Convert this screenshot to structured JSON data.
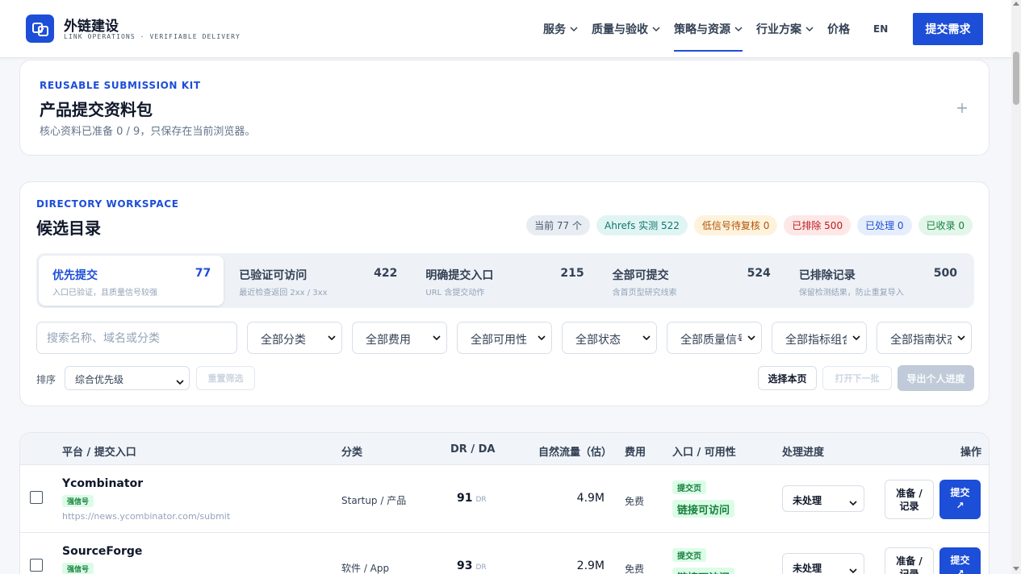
{
  "header": {
    "brand_name": "外链建设",
    "brand_sub": "LINK OPERATIONS · VERIFIABLE DELIVERY",
    "nav": [
      {
        "label": "服务"
      },
      {
        "label": "质量与验收"
      },
      {
        "label": "策略与资源"
      },
      {
        "label": "行业方案"
      },
      {
        "label": "价格"
      }
    ],
    "lang": "EN",
    "cta": "提交需求"
  },
  "kit": {
    "eyebrow": "REUSABLE SUBMISSION KIT",
    "title": "产品提交资料包",
    "desc": "核心资料已准备 0 / 9，只保存在当前浏览器。",
    "expand_icon": "plus-icon"
  },
  "directory": {
    "eyebrow": "DIRECTORY WORKSPACE",
    "title": "候选目录",
    "pills": [
      {
        "label": "当前 77 个",
        "bg": "#e8edf4",
        "fg": "#475569"
      },
      {
        "label": "Ahrefs 实测 522",
        "bg": "#e0f5f3",
        "fg": "#0f766e"
      },
      {
        "label": "低信号待复核 0",
        "bg": "#fdf3dc",
        "fg": "#b45309"
      },
      {
        "label": "已排除 500",
        "bg": "#fde7e7",
        "fg": "#b91c1c"
      },
      {
        "label": "已处理 0",
        "bg": "#e6eefc",
        "fg": "#1d4ed8"
      },
      {
        "label": "已收录 0",
        "bg": "#e3f6ea",
        "fg": "#15803d"
      }
    ],
    "tabs": [
      {
        "label": "优先提交",
        "count": "77",
        "sub": "入口已验证，且质量信号较强"
      },
      {
        "label": "已验证可访问",
        "count": "422",
        "sub": "最近检查返回 2xx / 3xx"
      },
      {
        "label": "明确提交入口",
        "count": "215",
        "sub": "URL 含提交动作"
      },
      {
        "label": "全部可提交",
        "count": "524",
        "sub": "含首页型研究线索"
      },
      {
        "label": "已排除记录",
        "count": "500",
        "sub": "保留检测结果，防止重复导入"
      }
    ],
    "search_placeholder": "搜索名称、域名或分类",
    "filters": [
      {
        "label": "全部分类"
      },
      {
        "label": "全部费用"
      },
      {
        "label": "全部可用性"
      },
      {
        "label": "全部状态"
      },
      {
        "label": "全部质量信号"
      },
      {
        "label": "全部指标组合"
      },
      {
        "label": "全部指南状态"
      }
    ],
    "sort_label": "排序",
    "sort_value": "综合优先级",
    "reset": "重置筛选",
    "select_page": "选择本页",
    "open_next": "打开下一批",
    "export": "导出个人进度"
  },
  "table": {
    "headers": {
      "platform": "平台 / 提交入口",
      "category": "分类",
      "dr": "DR / DA",
      "traffic": "自然流量（估）",
      "fee": "费用",
      "entry": "入口 / 可用性",
      "progress": "处理进度",
      "actions": "操作"
    },
    "rows": [
      {
        "name": "Ycombinator",
        "tag": "强信号",
        "url": "https://news.ycombinator.com/submit",
        "category": "Startup / 产品",
        "dr": "91",
        "dr_unit": "DR",
        "traffic": "4.9M",
        "fee": "免费",
        "entry": "提交页",
        "access": "链接可访问",
        "status": "未处理",
        "prep_line1": "准备 /",
        "prep_line2": "记录",
        "submit_line1": "提交",
        "submit_line2": "↗"
      },
      {
        "name": "SourceForge",
        "tag": "强信号",
        "url": "",
        "category": "软件 / App",
        "dr": "93",
        "dr_unit": "DR",
        "traffic": "2.9M",
        "fee": "免费",
        "entry": "提交页",
        "access": "链接可访问",
        "status": "未处理",
        "prep_line1": "准备 /",
        "prep_line2": "记录",
        "submit_line1": "提交",
        "submit_line2": "↗"
      }
    ]
  }
}
